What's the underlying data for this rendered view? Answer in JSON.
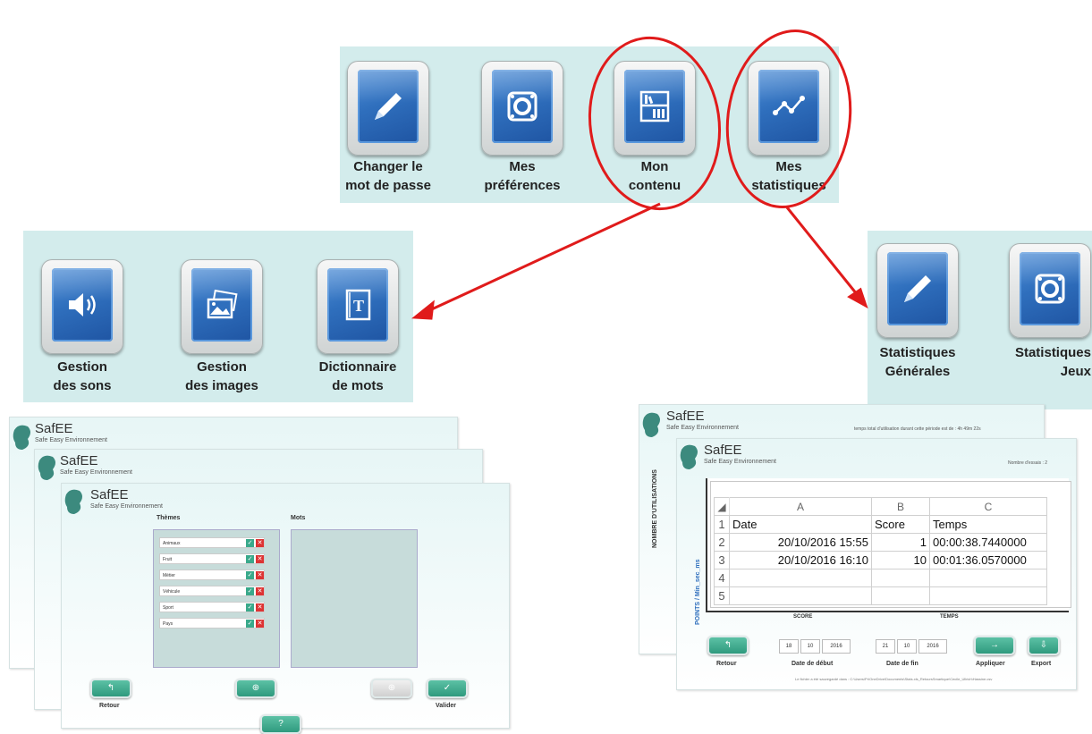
{
  "menu_top": {
    "items": [
      {
        "label_l1": "Changer le",
        "label_l2": "mot de passe",
        "icon": "pencil-icon"
      },
      {
        "label_l1": "Mes",
        "label_l2": "préférences",
        "icon": "speaker-box-icon"
      },
      {
        "label_l1": "Mon",
        "label_l2": "contenu",
        "icon": "bookshelf-icon"
      },
      {
        "label_l1": "Mes",
        "label_l2": "statistiques",
        "icon": "line-chart-icon"
      }
    ]
  },
  "menu_content": {
    "items": [
      {
        "label_l1": "Gestion",
        "label_l2": "des sons",
        "icon": "volume-icon"
      },
      {
        "label_l1": "Gestion",
        "label_l2": "des images",
        "icon": "images-icon"
      },
      {
        "label_l1": "Dictionnaire",
        "label_l2": "de mots",
        "icon": "dictionary-icon"
      }
    ]
  },
  "menu_stats": {
    "items": [
      {
        "label_l1": "Statistiques",
        "label_l2": "Générales",
        "icon": "pencil-icon"
      },
      {
        "label_l1": "Statistiques",
        "label_l2": "Jeux",
        "icon": "speaker-box-icon"
      }
    ]
  },
  "app": {
    "name": "SafEE",
    "subtitle": "Safe Easy Environnement"
  },
  "content_window": {
    "themes_header": "Thèmes",
    "mots_header": "Mots",
    "themes": [
      "Animaux",
      "Fruit",
      "Métier",
      "Véhicule",
      "Sport",
      "Pays"
    ],
    "retour": "Retour",
    "valider": "Valider",
    "help": "?"
  },
  "stats_window": {
    "total_time_text": "temps total d'utilisation durant cette période est de : 4h 49m 22s",
    "nb_essais_text": "Nombre d'essais : 2",
    "y_axis_label": "NOMBRE D'UTILISATIONS",
    "y_axis_label2": "POINTS / Min_sec_ms",
    "score_label": "SCORE",
    "temps_label": "TEMPS",
    "retour": "Retour",
    "date_debut_label": "Date de début",
    "date_fin_label": "Date de fin",
    "appliquer": "Appliquer",
    "export": "Export",
    "date_debut": [
      "18",
      "10",
      "2016"
    ],
    "date_fin": [
      "21",
      "10",
      "2016"
    ],
    "footer_text": "Le fichier a été sauvegardé dans : C:\\Users\\Pr\\OneDrive\\Documents\\Stats.xls_RetoursSmartique\\Cecile_Ullrich\\Hassine.csv"
  },
  "spreadsheet": {
    "col_headers": [
      "A",
      "B",
      "C"
    ],
    "rows": [
      {
        "n": "1",
        "a": "Date",
        "b": "Score",
        "c": "Temps"
      },
      {
        "n": "2",
        "a": "20/10/2016 15:55",
        "b": "1",
        "c": "00:00:38.7440000"
      },
      {
        "n": "3",
        "a": "20/10/2016 16:10",
        "b": "10",
        "c": "00:01:36.0570000"
      },
      {
        "n": "4",
        "a": "",
        "b": "",
        "c": ""
      },
      {
        "n": "5",
        "a": "",
        "b": "",
        "c": ""
      }
    ]
  },
  "colors": {
    "panel": "#d3ecec",
    "tile_blue": "#2f6fbd",
    "annotation_red": "#e01b1b",
    "button_green": "#3aa98b"
  }
}
